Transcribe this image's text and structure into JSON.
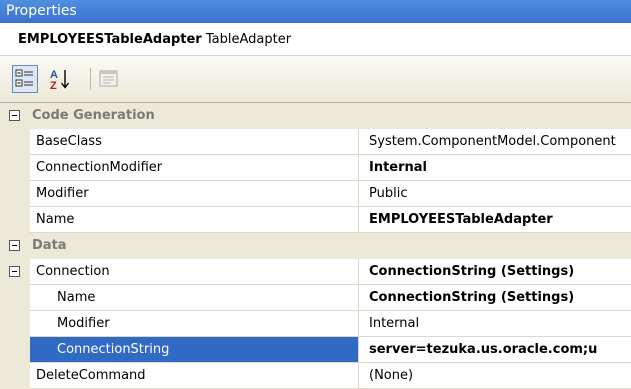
{
  "window": {
    "title": "Properties"
  },
  "object_selector": {
    "name": "EMPLOYEESTableAdapter",
    "type": "TableAdapter"
  },
  "toolbar": {
    "buttons": [
      {
        "icon": "categorized-icon",
        "active": true
      },
      {
        "icon": "alphabetical-sort-icon",
        "active": false
      },
      {
        "icon": "property-pages-icon",
        "active": false
      }
    ],
    "alphabetical_glyph_top": "A",
    "alphabetical_glyph_bottom": "Z"
  },
  "grid": {
    "category_code_generation": "Code Generation",
    "base_class": {
      "name": "BaseClass",
      "value": "System.ComponentModel.Component"
    },
    "connection_modifier": {
      "name": "ConnectionModifier",
      "value": "Internal"
    },
    "modifier": {
      "name": "Modifier",
      "value": "Public"
    },
    "name": {
      "name": "Name",
      "value": "EMPLOYEESTableAdapter"
    },
    "category_data": "Data",
    "connection": {
      "name": "Connection",
      "value": "ConnectionString (Settings)"
    },
    "connection_name": {
      "name": "Name",
      "value": "ConnectionString (Settings)"
    },
    "connection_modifier2": {
      "name": "Modifier",
      "value": "Internal"
    },
    "connection_string": {
      "name": "ConnectionString",
      "value": "server=tezuka.us.oracle.com;u"
    },
    "delete_command": {
      "name": "DeleteCommand",
      "value": "(None)"
    }
  },
  "colors": {
    "titlebar": "#3a72cc",
    "selection": "#316ac5",
    "category_bg": "#ece9d8"
  }
}
